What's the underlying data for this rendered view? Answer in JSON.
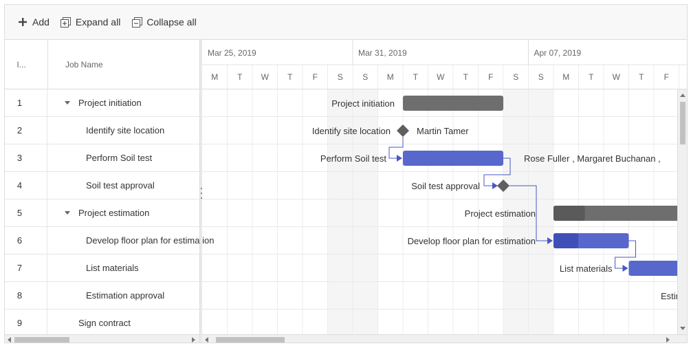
{
  "toolbar": {
    "add_label": "Add",
    "expand_label": "Expand all",
    "collapse_label": "Collapse all"
  },
  "grid": {
    "col_id": "I...",
    "col_name": "Job Name",
    "rows": [
      {
        "id": "1",
        "name": "Project initiation",
        "parent": true
      },
      {
        "id": "2",
        "name": "Identify site location",
        "parent": false
      },
      {
        "id": "3",
        "name": "Perform Soil test",
        "parent": false
      },
      {
        "id": "4",
        "name": "Soil test approval",
        "parent": false
      },
      {
        "id": "5",
        "name": "Project estimation",
        "parent": true
      },
      {
        "id": "6",
        "name": "Develop floor plan for estimation",
        "parent": false
      },
      {
        "id": "7",
        "name": "List materials",
        "parent": false
      },
      {
        "id": "8",
        "name": "Estimation approval",
        "parent": false
      },
      {
        "id": "9",
        "name": "Sign contract",
        "parent": false,
        "flat": true
      }
    ]
  },
  "timeline": {
    "weeks": [
      "Mar 25, 2019",
      "Mar 31, 2019",
      "Apr 07, 2019"
    ],
    "days": [
      "M",
      "T",
      "W",
      "T",
      "F",
      "S",
      "S",
      "M",
      "T",
      "W",
      "T",
      "F",
      "S",
      "S",
      "M",
      "T",
      "W",
      "T",
      "F"
    ],
    "weekend_indices": [
      5,
      6,
      12,
      13
    ]
  },
  "gantt": {
    "labels": {
      "row1_left": "Project initiation",
      "row2_left": "Identify site location",
      "row2_right": "Martin Tamer",
      "row3_left": "Perform Soil test",
      "row3_right": "Rose Fuller , Margaret Buchanan ,",
      "row4_left": "Soil test approval",
      "row5_left": "Project estimation",
      "row6_left": "Develop floor plan for estimation",
      "row7_left": "List materials",
      "row8_left": "Estimation approval"
    },
    "tasks": [
      {
        "row": 0,
        "type": "summary",
        "start": 8,
        "days": 4,
        "progress": 0
      },
      {
        "row": 1,
        "type": "milestone",
        "at": 8
      },
      {
        "row": 2,
        "type": "task",
        "start": 8,
        "days": 4,
        "progress": 0
      },
      {
        "row": 3,
        "type": "milestone",
        "at": 12
      },
      {
        "row": 4,
        "type": "summary",
        "start": 14,
        "days": 5,
        "progress": 0.25
      },
      {
        "row": 5,
        "type": "task",
        "start": 14,
        "days": 3,
        "progress": 0.33
      },
      {
        "row": 6,
        "type": "task",
        "start": 17,
        "days": 2,
        "progress": 0
      }
    ],
    "colors": {
      "summary": "#6e6e6e",
      "summary_progress": "#5a5a5a",
      "task": "#5767cc",
      "task_progress": "#3f4fb8",
      "connector": "#4758c4",
      "milestone": "#5f5f5f",
      "weekend": "#f5f5f5",
      "grid_line": "#ececec"
    }
  }
}
